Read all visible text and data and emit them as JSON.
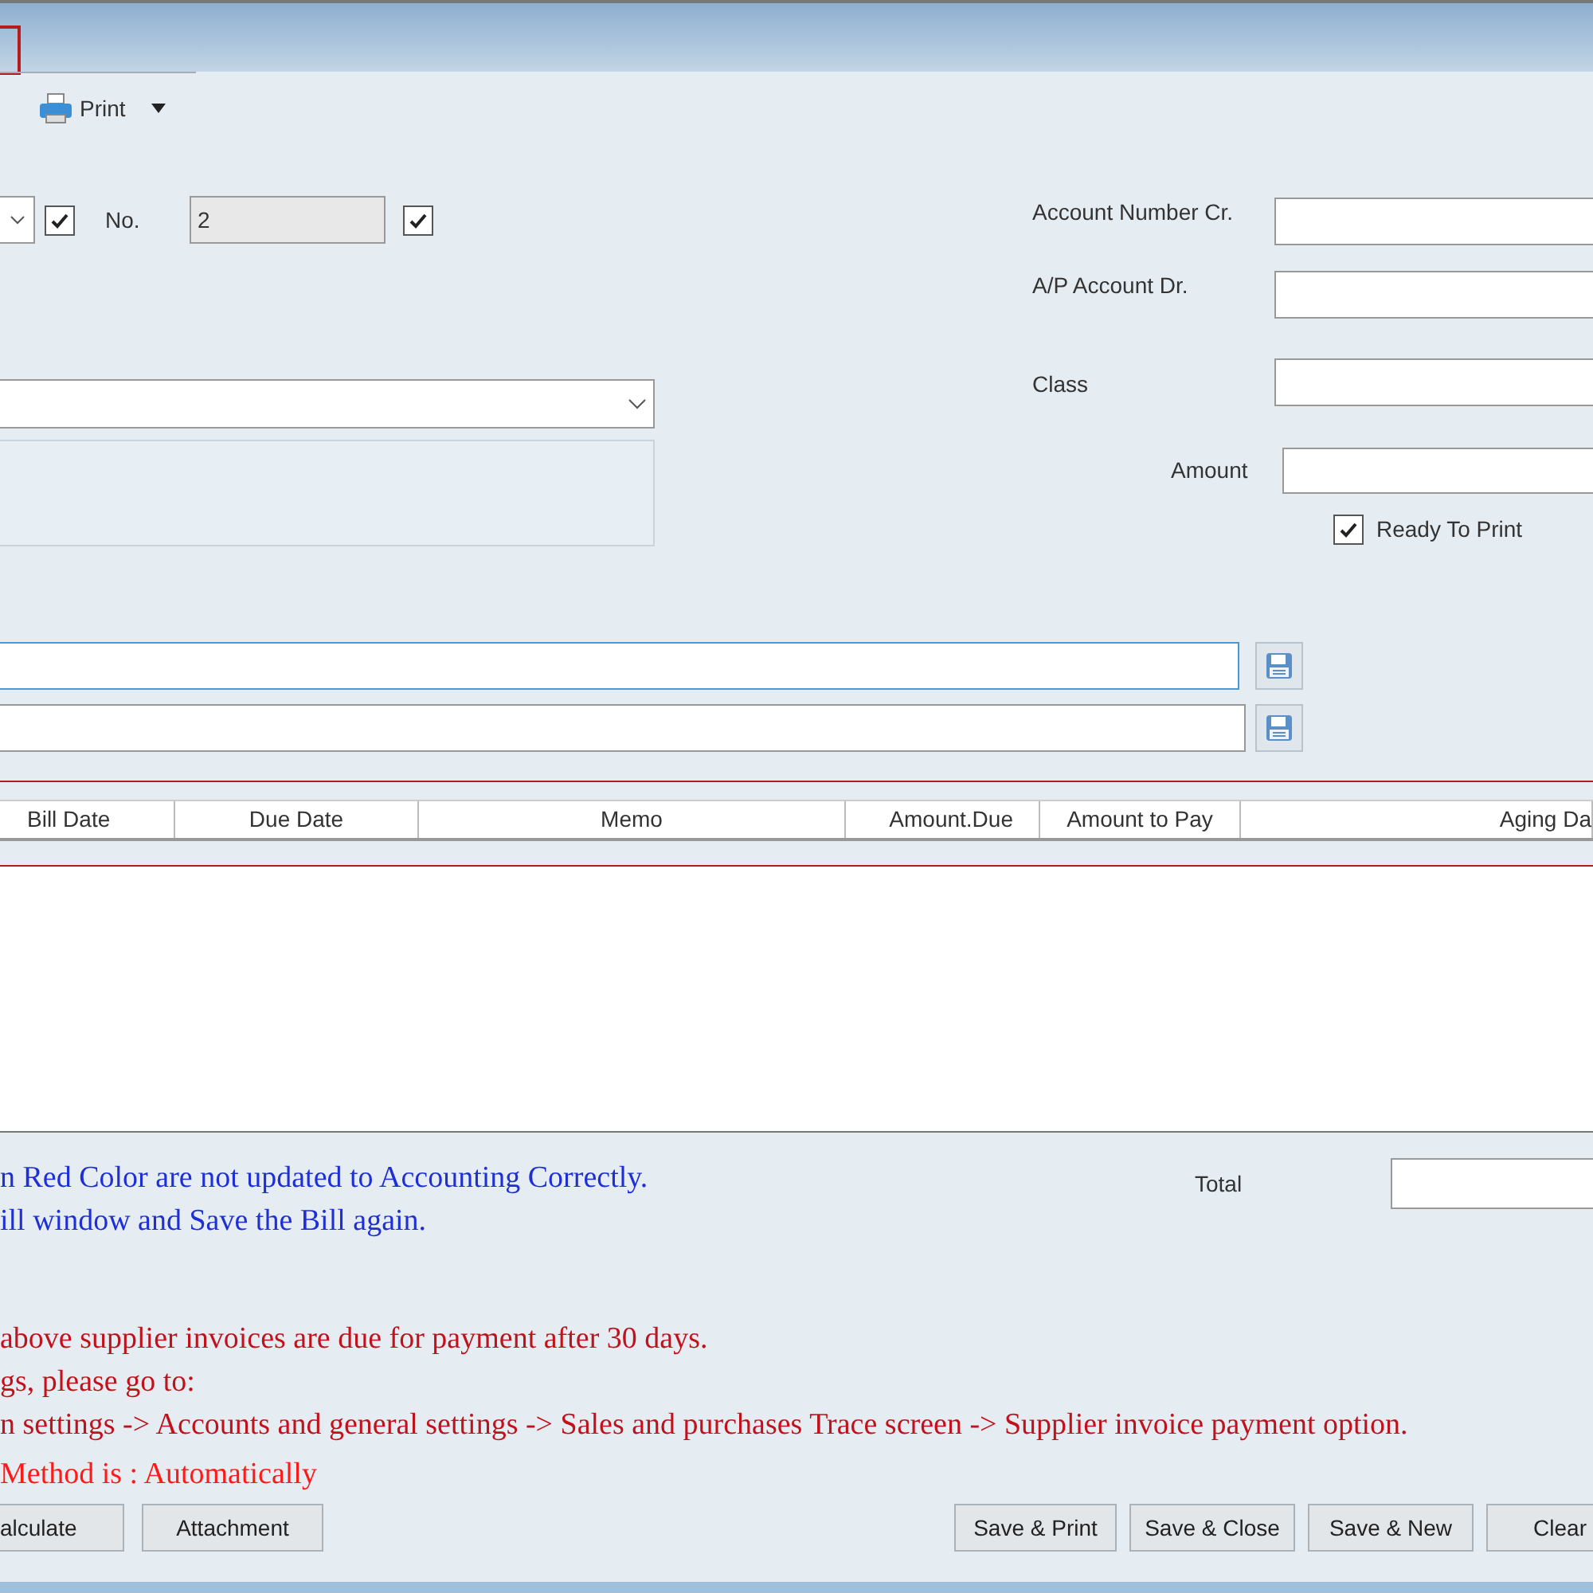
{
  "toolbar": {
    "buttons": [
      {
        "label": "Print",
        "has_menu": true
      }
    ]
  },
  "header": {
    "checkbox_1": {
      "checked": true
    },
    "number": {
      "label": "No.",
      "value": "2"
    },
    "checkbox_2": {
      "checked": true
    }
  },
  "account_fields": [
    {
      "label": "Account Number Cr."
    },
    {
      "label": "A/P Account Dr."
    },
    {
      "label": "Class"
    }
  ],
  "amount": {
    "label": "Amount"
  },
  "ready_to_print": {
    "label": "Ready To Print",
    "checked": true
  },
  "table": {
    "columns": [
      "Bill Date",
      "Due Date",
      "Memo",
      "Amount.Due",
      "Amount to Pay",
      "Aging Da"
    ]
  },
  "messages": [
    {
      "kind": "info",
      "text": "n Red Color are not updated to Accounting Correctly."
    },
    {
      "kind": "info",
      "text": "ill window and Save the Bill again."
    },
    {
      "kind": "warning",
      "text": "above supplier invoices are due for payment after 30 days."
    },
    {
      "kind": "warning",
      "text": "gs, please go to:"
    },
    {
      "kind": "warning",
      "text": "n settings -> Accounts and general settings  -> Sales and purchases Trace screen -> Supplier invoice payment option."
    },
    {
      "kind": "alert",
      "text": "Method is : Automatically"
    }
  ],
  "total": {
    "label": "Total"
  },
  "buttons_left": [
    "alculate",
    "Attachment"
  ],
  "buttons_right": [
    "Save & Print",
    "Save & Close",
    "Save & New",
    "Clear"
  ]
}
